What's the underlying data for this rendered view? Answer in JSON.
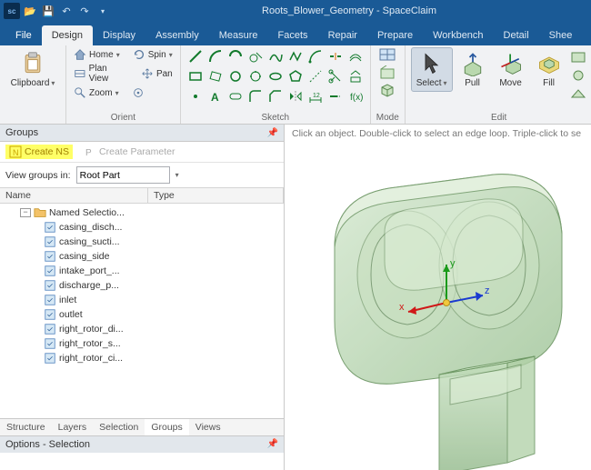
{
  "window": {
    "title": "Roots_Blower_Geometry - SpaceClaim"
  },
  "menu": {
    "file": "File",
    "tabs": [
      "Design",
      "Display",
      "Assembly",
      "Measure",
      "Facets",
      "Repair",
      "Prepare",
      "Workbench",
      "Detail",
      "Shee"
    ]
  },
  "ribbon": {
    "clipboard": {
      "label": "Clipboard",
      "paste": "Clipboard"
    },
    "orient": {
      "label": "Orient",
      "home": "Home",
      "spin": "Spin",
      "planview": "Plan View",
      "pan": "Pan",
      "zoom": "Zoom"
    },
    "sketch": {
      "label": "Sketch"
    },
    "mode": {
      "label": "Mode"
    },
    "edit": {
      "label": "Edit",
      "select": "Select",
      "pull": "Pull",
      "move": "Move",
      "fill": "Fill"
    }
  },
  "groups_panel": {
    "title": "Groups",
    "create_ns": "Create NS",
    "create_param": "Create Parameter",
    "view_in_label": "View groups in:",
    "view_in_value": "Root Part",
    "col_name": "Name",
    "col_type": "Type",
    "root": "Named Selectio...",
    "items": [
      "casing_disch...",
      "casing_sucti...",
      "casing_side",
      "intake_port_...",
      "discharge_p...",
      "inlet",
      "outlet",
      "right_rotor_di...",
      "right_rotor_s...",
      "right_rotor_ci..."
    ],
    "bottom_tabs": [
      "Structure",
      "Layers",
      "Selection",
      "Groups",
      "Views"
    ]
  },
  "options": {
    "title": "Options - Selection"
  },
  "viewport": {
    "hint": "Click an object. Double-click to select an edge loop. Triple-click to se",
    "axes": {
      "x": "x",
      "y": "y",
      "z": "z"
    }
  }
}
